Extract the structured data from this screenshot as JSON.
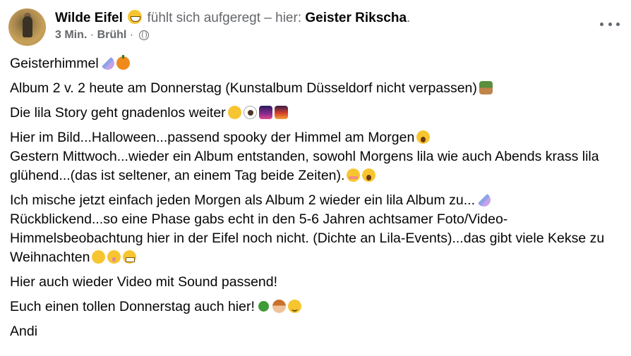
{
  "post": {
    "author": "Wilde Eifel",
    "feeling": "fühlt sich aufgeregt",
    "at_sep": " – hier: ",
    "place": "Geister Rikscha",
    "end_dot": ".",
    "time": "3 Min.",
    "meta_sep1": " · ",
    "location": "Brühl",
    "meta_sep2": " · "
  },
  "text": {
    "p1": "Geisterhimmel",
    "p2": "Album 2 v. 2 heute am Donnerstag (Kunstalbum Düsseldorf nicht verpassen)",
    "p3": "Die lila Story geht gnadenlos weiter",
    "p4_l1": "Hier im Bild...Halloween...passend spooky der Himmel am Morgen",
    "p4_l2": "Gestern Mittwoch...wieder ein Album entstanden, sowohl Morgens lila wie auch Abends krass lila",
    "p4_l3": "glühend...(das ist seltener, an einem Tag beide Zeiten).",
    "p5_l1": "Ich mische jetzt einfach jeden Morgen als Album 2 wieder ein lila Album zu...",
    "p5_l2": "Rückblickend...so eine Phase gabs echt in den 5-6 Jahren achtsamer Foto/Video-",
    "p5_l3": "Himmelsbeobachtung hier in der Eifel noch nicht. (Dichte an Lila-Events)...das gibt viele Kekse zu",
    "p5_l4": "Weihnachten",
    "p6": "Hier auch wieder Video mit Sound passend!",
    "p7": "Euch einen tollen Donnerstag auch hier!",
    "p8": "Andi"
  },
  "icons": [
    "grinning-face-icon",
    "globe-icon",
    "more-options-icon",
    "unicorn-icon",
    "pumpkin-icon",
    "fairy-icon",
    "eye-icon",
    "purple-sky-icon",
    "sunset-icon",
    "scream-icon",
    "flushed-icon",
    "grimace-icon",
    "hushed-icon",
    "clover-icon",
    "person-icon",
    "smile-icon"
  ]
}
